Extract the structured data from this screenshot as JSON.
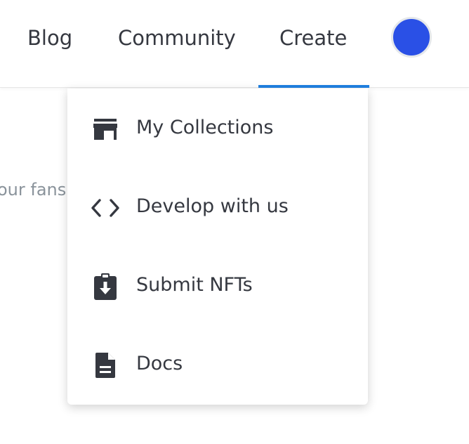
{
  "nav": {
    "items": [
      {
        "label": "Blog"
      },
      {
        "label": "Community"
      },
      {
        "label": "Create"
      }
    ],
    "active": "Create",
    "accent_color": "#2081e2",
    "avatar_color": "#2a50e6"
  },
  "background": {
    "partial_text": "our fans"
  },
  "dropdown": {
    "items": [
      {
        "label": "My Collections",
        "icon": "storefront-icon"
      },
      {
        "label": "Develop with us",
        "icon": "code-icon"
      },
      {
        "label": "Submit NFTs",
        "icon": "clipboard-download-icon"
      },
      {
        "label": "Docs",
        "icon": "document-icon"
      }
    ]
  }
}
